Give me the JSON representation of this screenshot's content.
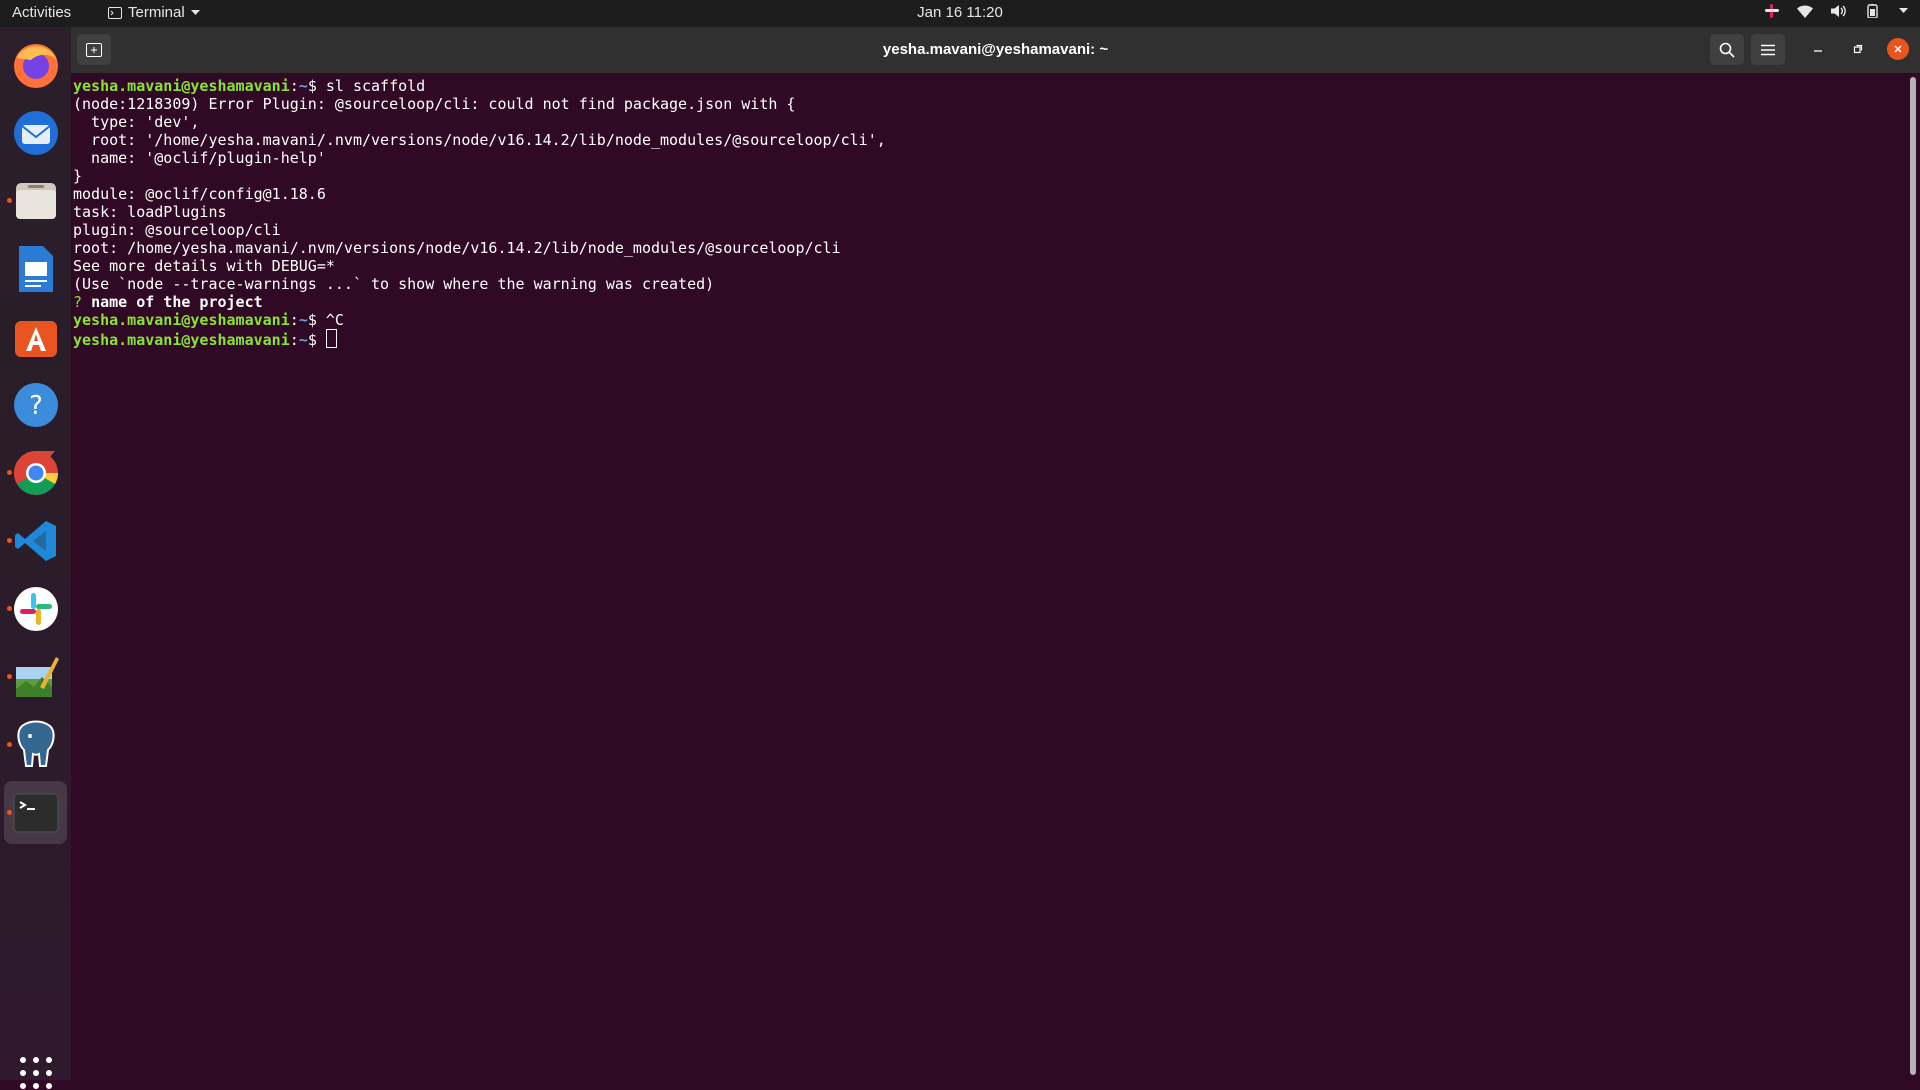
{
  "topbar": {
    "activities": "Activities",
    "app_menu": "Terminal",
    "clock": "Jan 16  11:20"
  },
  "dock": {
    "items": [
      {
        "name": "Firefox",
        "running": false
      },
      {
        "name": "Thunderbird",
        "running": false
      },
      {
        "name": "Files",
        "running": true
      },
      {
        "name": "LibreOffice Writer",
        "running": false
      },
      {
        "name": "Ubuntu Software",
        "running": false
      },
      {
        "name": "Help",
        "running": false
      },
      {
        "name": "Google Chrome",
        "running": true
      },
      {
        "name": "Visual Studio Code",
        "running": true
      },
      {
        "name": "Slack",
        "running": true
      },
      {
        "name": "Image Editor",
        "running": true
      },
      {
        "name": "pgAdmin",
        "running": true
      },
      {
        "name": "Terminal",
        "running": true,
        "active": true
      }
    ]
  },
  "window": {
    "title": "yesha.mavani@yeshamavani: ~"
  },
  "terminal": {
    "prompt_user": "yesha.mavani@yeshamavani",
    "prompt_path": "~",
    "command1": "sl scaffold",
    "output": [
      "(node:1218309) Error Plugin: @sourceloop/cli: could not find package.json with {",
      "  type: 'dev',",
      "  root: '/home/yesha.mavani/.nvm/versions/node/v16.14.2/lib/node_modules/@sourceloop/cli',",
      "  name: '@oclif/plugin-help'",
      "}",
      "module: @oclif/config@1.18.6",
      "task: loadPlugins",
      "plugin: @sourceloop/cli",
      "root: /home/yesha.mavani/.nvm/versions/node/v16.14.2/lib/node_modules/@sourceloop/cli",
      "See more details with DEBUG=*",
      "(Use `node --trace-warnings ...` to show where the warning was created)"
    ],
    "question_mark": "?",
    "question": "name of the project",
    "command2": "^C"
  },
  "colors": {
    "terminal_bg": "#300a24",
    "prompt_user": "#8ae234",
    "prompt_path": "#729fcf",
    "close_button": "#e95420"
  }
}
